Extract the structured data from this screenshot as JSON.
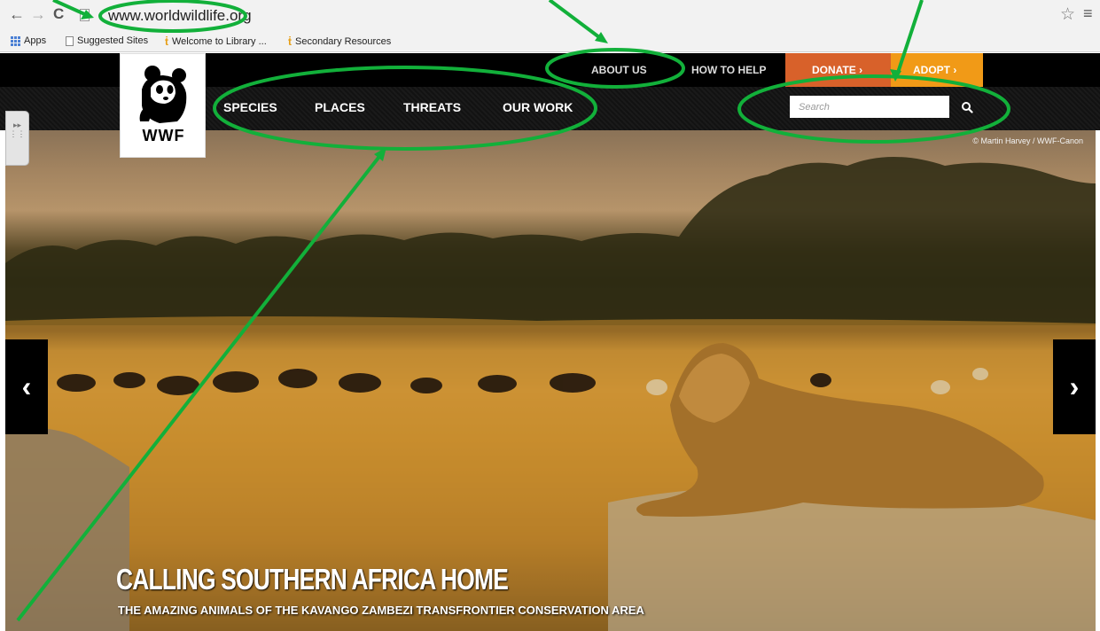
{
  "browser": {
    "url": "www.worldwildlife.org",
    "bookmarks": {
      "apps": "Apps",
      "suggested": "Suggested Sites",
      "welcome": "Welcome to Library ...",
      "secondary": "Secondary Resources"
    }
  },
  "header": {
    "logo_text": "WWF",
    "utility_links": {
      "about": "ABOUT US",
      "help": "HOW TO HELP"
    },
    "donate": "DONATE ›",
    "adopt": "ADOPT ›",
    "main_nav": {
      "species": "SPECIES",
      "places": "PLACES",
      "threats": "THREATS",
      "our_work": "OUR WORK"
    },
    "search": {
      "placeholder": "Search"
    }
  },
  "hero": {
    "photo_credit": "© Martin Harvey / WWF-Canon",
    "title": "CALLING SOUTHERN AFRICA HOME",
    "subtitle": "THE AMAZING ANIMALS OF THE KAVANGO ZAMBEZI TRANSFRONTIER CONSERVATION AREA",
    "prev": "‹",
    "next": "›"
  },
  "colors": {
    "donate": "#d8612a",
    "adopt": "#f19a17",
    "annotation": "#12b03a"
  }
}
